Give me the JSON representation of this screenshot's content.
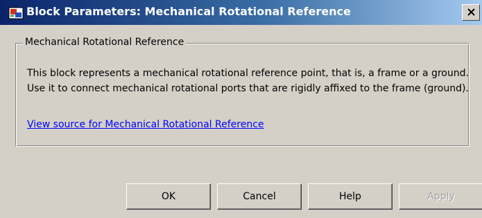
{
  "window": {
    "title": "Block Parameters: Mechanical Rotational Reference",
    "icon": "simulink-block-icon",
    "close_glyph": "✕"
  },
  "group": {
    "title": "Mechanical Rotational Reference",
    "description": "This block represents a mechanical rotational reference point, that is, a frame or a ground. Use it to connect mechanical rotational ports that are rigidly affixed to the frame (ground).",
    "link_text": "View source for Mechanical Rotational Reference"
  },
  "buttons": {
    "ok": "OK",
    "cancel": "Cancel",
    "help": "Help",
    "apply": "Apply"
  },
  "colors": {
    "title_gradient_start": "#0a246a",
    "title_gradient_end": "#a6caf0",
    "dialog_background": "#d4d0c8",
    "link": "#0000ff"
  }
}
